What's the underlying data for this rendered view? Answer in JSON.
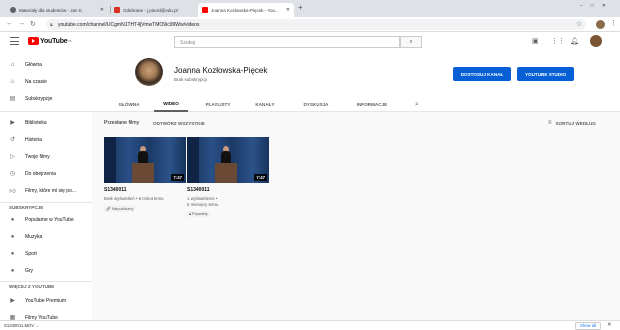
{
  "browser": {
    "tabs": [
      {
        "title": "Materiały dla studentów - Jan K.",
        "icon": "document-icon",
        "color": "#5f6368"
      },
      {
        "title": "Odebrane - j.pieckl@edu.pl",
        "icon": "gmail-icon",
        "color": "#d93025"
      },
      {
        "title": "Joanna Kozłowska-Pięcek - You...",
        "icon": "youtube-icon",
        "color": "#ff0000"
      }
    ],
    "new_tab": "+",
    "url": "youtube.com/channel/UCgmN1THT4jVmwTMO9ic99Ww/videos"
  },
  "youtube": {
    "logo_text": "YouTube",
    "logo_sup": "PL",
    "search_placeholder": "Szukaj"
  },
  "sidebar": {
    "items_top": [
      {
        "label": "Główna",
        "icon": "home-icon"
      },
      {
        "label": "Na czasie",
        "icon": "trending-icon"
      },
      {
        "label": "Subskrypcje",
        "icon": "subscriptions-icon"
      }
    ],
    "items_library": [
      {
        "label": "Biblioteka",
        "icon": "library-icon"
      },
      {
        "label": "Historia",
        "icon": "history-icon"
      },
      {
        "label": "Twoje filmy",
        "icon": "your-videos-icon"
      },
      {
        "label": "Do obejrzenia",
        "icon": "watch-later-icon"
      },
      {
        "label": "Filmy, które mi się po...",
        "icon": "liked-icon"
      }
    ],
    "subs_heading": "SUBSKRYPCJE",
    "items_subs": [
      {
        "label": "Popularne w YouTube",
        "icon": "popular-icon"
      },
      {
        "label": "Muzyka",
        "icon": "music-icon"
      },
      {
        "label": "Sport",
        "icon": "sport-icon"
      },
      {
        "label": "Gry",
        "icon": "games-icon"
      }
    ],
    "more_heading": "WIĘCEJ Z YOUTUBE",
    "items_more": [
      {
        "label": "YouTube Premium",
        "icon": "premium-icon"
      },
      {
        "label": "Filmy YouTube",
        "icon": "movies-icon"
      }
    ]
  },
  "channel": {
    "name": "Joanna Kozłowska-Pięcek",
    "subs": "Brak subskrypcji",
    "customize_button": "DOSTOSUJ KANAŁ",
    "studio_button": "YOUTUBE STUDIO",
    "tabs": [
      "GŁÓWNA",
      "WIDEO",
      "PLAYLISTY",
      "KANAŁY",
      "DYSKUSJA",
      "INFORMACJE"
    ],
    "active_tab": "WIDEO"
  },
  "section": {
    "title": "Przesłane filmy",
    "play_all": "ODTWÓRZ WSZYSTKIE",
    "sort": "SORTUJ WEDŁUG"
  },
  "videos": [
    {
      "title": "S1340011",
      "duration": "7:47",
      "meta1": "Brak wyświetleń • 6 minut temu",
      "meta2": "",
      "badge": "Niepubliczny",
      "badge_icon": "link-icon"
    },
    {
      "title": "S1340011",
      "duration": "7:47",
      "meta1": "1 wyświetlenie •",
      "meta2": "5 miesięcy temu",
      "badge": "Prywatny",
      "badge_icon": "lock-icon"
    }
  ],
  "downloads": {
    "item": "S1340011.MOV ...",
    "show_all": "Show all"
  }
}
